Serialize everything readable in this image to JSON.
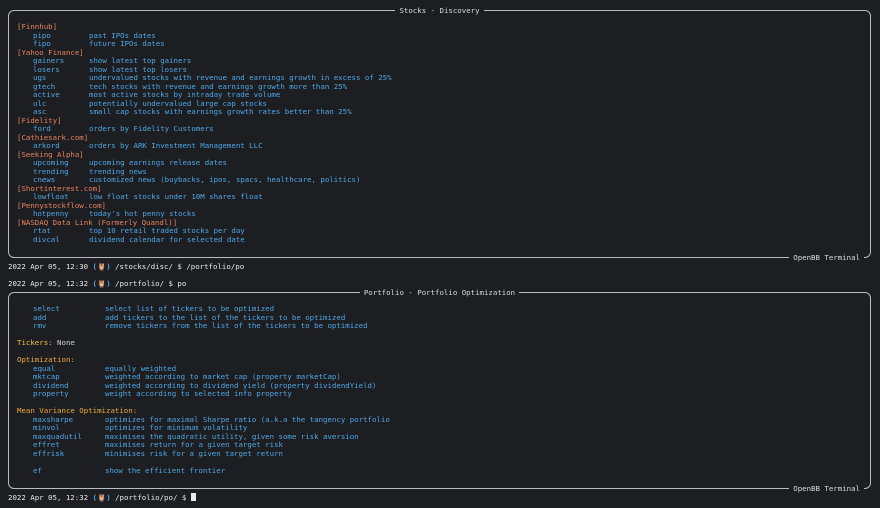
{
  "discovery": {
    "title": "Stocks - Discovery",
    "footer": "OpenBB Terminal",
    "sections": [
      {
        "category": "[Finnhub]",
        "items": [
          {
            "cmd": "pipo",
            "desc": "past IPOs dates"
          },
          {
            "cmd": "fipo",
            "desc": "future IPOs dates"
          }
        ]
      },
      {
        "category": "[Yahoo Finance]",
        "items": [
          {
            "cmd": "gainers",
            "desc": "show latest top gainers"
          },
          {
            "cmd": "losers",
            "desc": "show latest top losers"
          },
          {
            "cmd": "ugs",
            "desc": "undervalued stocks with revenue and earnings growth in excess of 25%"
          },
          {
            "cmd": "gtech",
            "desc": "tech stocks with revenue and earnings growth more than 25%"
          },
          {
            "cmd": "active",
            "desc": "most active stocks by intraday trade volume"
          },
          {
            "cmd": "ulc",
            "desc": "potentially undervalued large cap stocks"
          },
          {
            "cmd": "asc",
            "desc": "small cap stocks with earnings growth rates better than 25%"
          }
        ]
      },
      {
        "category": "[Fidelity]",
        "items": [
          {
            "cmd": "ford",
            "desc": "orders by Fidelity Customers"
          }
        ]
      },
      {
        "category": "[Cathiesark.com]",
        "items": [
          {
            "cmd": "arkord",
            "desc": "orders by ARK Investment Management LLC"
          }
        ]
      },
      {
        "category": "[Seeking Alpha]",
        "items": [
          {
            "cmd": "upcoming",
            "desc": "upcoming earnings release dates"
          },
          {
            "cmd": "trending",
            "desc": "trending news"
          },
          {
            "cmd": "cnews",
            "desc": "customized news (buybacks, ipos, spacs, healthcare, politics)"
          }
        ]
      },
      {
        "category": "[Shortinterest.com]",
        "items": [
          {
            "cmd": "lowfloat",
            "desc": "low float stocks under 10M shares float"
          }
        ]
      },
      {
        "category": "[Pennystockflow.com]",
        "items": [
          {
            "cmd": "hotpenny",
            "desc": "today's hot penny stocks"
          }
        ]
      },
      {
        "category": "[NASDAQ Data Link (Formerly Quandl)]",
        "items": [
          {
            "cmd": "rtat",
            "desc": "top 10 retail traded stocks per day"
          },
          {
            "cmd": "divcal",
            "desc": "dividend calendar for selected date"
          }
        ]
      }
    ]
  },
  "prompt1": {
    "time": "2022 Apr 05, 12:30",
    "owl": "(🦉)",
    "path": " /stocks/disc/ $ ",
    "input": "/portfolio/po"
  },
  "prompt2": {
    "time": "2022 Apr 05, 12:32",
    "owl": "(🦉)",
    "path": " /portfolio/ $ ",
    "input": "po"
  },
  "prompt3": {
    "time": "2022 Apr 05, 12:32",
    "owl": "(🦉)",
    "path": " /portfolio/po/ $ ",
    "input": ""
  },
  "portfolio": {
    "title": "Portfolio - Portfolio Optimization",
    "footer": "OpenBB Terminal",
    "ticker_cmds": [
      {
        "cmd": "select",
        "desc": "select list of tickers to be optimized"
      },
      {
        "cmd": "add",
        "desc": "add tickers to the list of the tickers to be optimized"
      },
      {
        "cmd": "rmv",
        "desc": "remove tickers from the list of the tickers to be optimized"
      }
    ],
    "tickers_label": "Tickers:",
    "tickers_value": " None",
    "optimization_label": "Optimization:",
    "optimization": [
      {
        "cmd": "equal",
        "desc": "equally weighted"
      },
      {
        "cmd": "mktcap",
        "desc": "weighted according to market cap (property marketCap)"
      },
      {
        "cmd": "dividend",
        "desc": "weighted according to dividend yield (property dividendYield)"
      },
      {
        "cmd": "property",
        "desc": "weight according to selected info property"
      }
    ],
    "mvo_label": "Mean Variance Optimization:",
    "mvo": [
      {
        "cmd": "maxsharpe",
        "desc": "optimizes for maximal Sharpe ratio (a.k.a the tangency portfolio"
      },
      {
        "cmd": "minvol",
        "desc": "optimizes for minimum volatility"
      },
      {
        "cmd": "maxquadutil",
        "desc": "maximises the quadratic utility, given some risk aversion"
      },
      {
        "cmd": "effret",
        "desc": "maximises return for a given target risk"
      },
      {
        "cmd": "effrisk",
        "desc": "minimises risk for a given target return"
      }
    ],
    "ef": {
      "cmd": "ef",
      "desc": "show the efficient frontier"
    }
  }
}
